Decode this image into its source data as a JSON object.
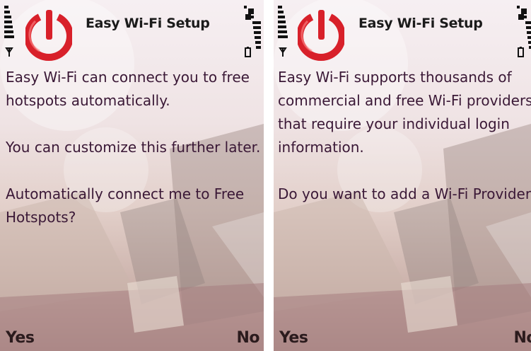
{
  "screens": [
    {
      "title": "Easy Wi-Fi Setup",
      "paragraphs": [
        [
          "Easy Wi-Fi can connect you to free",
          "hotspots automatically."
        ],
        [
          "You can customize this further later."
        ],
        [
          "Automatically connect me to Free",
          "Hotspots?"
        ]
      ],
      "left_softkey": "Yes",
      "right_softkey": "No"
    },
    {
      "title": "Easy Wi-Fi Setup",
      "paragraphs": [
        [
          "Easy Wi-Fi supports thousands of",
          "commercial and free Wi-Fi providers",
          "that require your individual login",
          "information."
        ],
        [
          "Do you want to add a Wi-Fi Provider?"
        ]
      ],
      "left_softkey": "Yes",
      "right_softkey": "No"
    }
  ],
  "colors": {
    "logo_red": "#d8202a",
    "text": "#3a1836",
    "title": "#1b1b1b"
  },
  "icons": [
    "signal-strength-icon",
    "antenna-icon",
    "battery-icon",
    "network-transfer-icon",
    "app-logo-icon"
  ]
}
